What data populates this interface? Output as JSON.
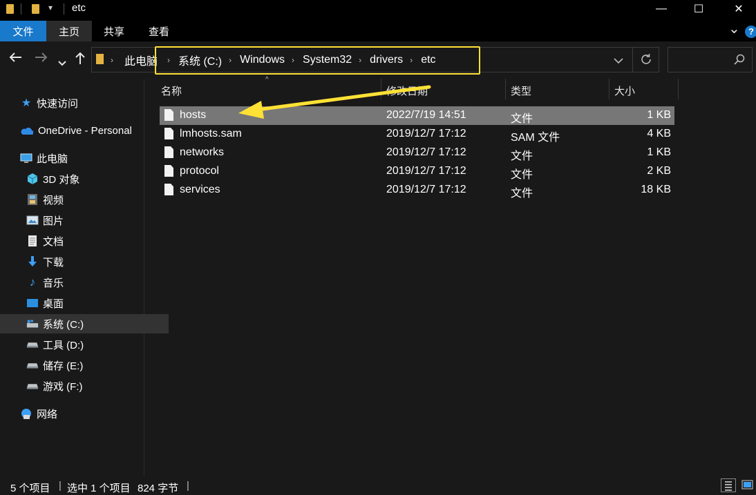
{
  "window": {
    "title": "etc",
    "controls": {
      "minimize": "—",
      "maximize": "☐",
      "close": "✕"
    },
    "qat_dropdown": "▾"
  },
  "ribbon": {
    "tabs": [
      "文件",
      "主页",
      "共享",
      "查看"
    ],
    "active_tab": "主页",
    "file_tab_color": "#1979ca",
    "expand_icon": "⌄",
    "help": "?"
  },
  "address": {
    "root": "此电脑",
    "crumbs": [
      "系统 (C:)",
      "Windows",
      "System32",
      "drivers",
      "etc"
    ],
    "highlight_color": "#ffe135"
  },
  "sidebar": {
    "items": [
      {
        "label": "快速访问",
        "icon": "star-icon"
      },
      {
        "label": "OneDrive - Personal",
        "icon": "cloud-icon"
      },
      {
        "label": "此电脑",
        "icon": "computer-icon"
      },
      {
        "label": "3D 对象",
        "icon": "cube-icon"
      },
      {
        "label": "视频",
        "icon": "film-icon"
      },
      {
        "label": "图片",
        "icon": "picture-icon"
      },
      {
        "label": "文档",
        "icon": "document-icon"
      },
      {
        "label": "下载",
        "icon": "download-icon"
      },
      {
        "label": "音乐",
        "icon": "music-icon"
      },
      {
        "label": "桌面",
        "icon": "desktop-icon"
      },
      {
        "label": "系统 (C:)",
        "icon": "windows-drive-icon",
        "selected": true
      },
      {
        "label": "工具 (D:)",
        "icon": "drive-icon"
      },
      {
        "label": "储存 (E:)",
        "icon": "drive-icon"
      },
      {
        "label": "游戏 (F:)",
        "icon": "drive-icon"
      },
      {
        "label": "网络",
        "icon": "network-icon"
      }
    ]
  },
  "columns": {
    "name": "名称",
    "date": "修改日期",
    "type": "类型",
    "size": "大小"
  },
  "files": [
    {
      "name": "hosts",
      "date": "2022/7/19 14:51",
      "type": "文件",
      "size": "1 KB",
      "selected": true
    },
    {
      "name": "lmhosts.sam",
      "date": "2019/12/7 17:12",
      "type": "SAM 文件",
      "size": "4 KB"
    },
    {
      "name": "networks",
      "date": "2019/12/7 17:12",
      "type": "文件",
      "size": "1 KB"
    },
    {
      "name": "protocol",
      "date": "2019/12/7 17:12",
      "type": "文件",
      "size": "2 KB"
    },
    {
      "name": "services",
      "date": "2019/12/7 17:12",
      "type": "文件",
      "size": "18 KB"
    }
  ],
  "status": {
    "count": "5 个项目",
    "selection": "选中 1 个项目",
    "bytes": "824 字节"
  },
  "annotation": {
    "arrow_color": "#ffe135"
  }
}
